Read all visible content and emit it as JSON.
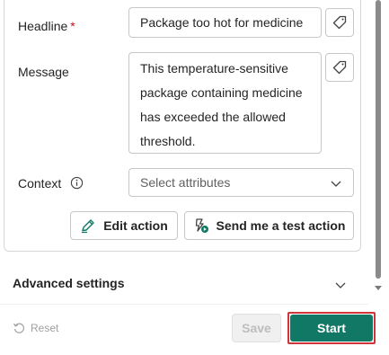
{
  "form": {
    "headline": {
      "label": "Headline",
      "required_mark": "*",
      "value": "Package too hot for medicine"
    },
    "message": {
      "label": "Message",
      "lines": [
        "This temperature-sensitive",
        "package containing medicine",
        "has exceeded the allowed",
        "threshold."
      ]
    },
    "context": {
      "label": "Context",
      "placeholder": "Select attributes"
    },
    "edit_action_label": "Edit action",
    "test_action_label": "Send me a test action"
  },
  "advanced": {
    "label": "Advanced settings"
  },
  "footer": {
    "reset_label": "Reset",
    "save_label": "Save",
    "start_label": "Start"
  },
  "icons": {
    "headline_tag": "tag-icon",
    "message_tag": "tag-icon",
    "context_info": "info-icon",
    "context_chevron": "chevron-down-icon",
    "edit_action": "edit-pen-icon",
    "test_action": "send-test-icon",
    "advanced_chevron": "chevron-down-icon",
    "reset": "reset-arrow-icon"
  },
  "colors": {
    "primary": "#117865",
    "highlight_outline": "#d13438",
    "required": "#c50f1f"
  }
}
